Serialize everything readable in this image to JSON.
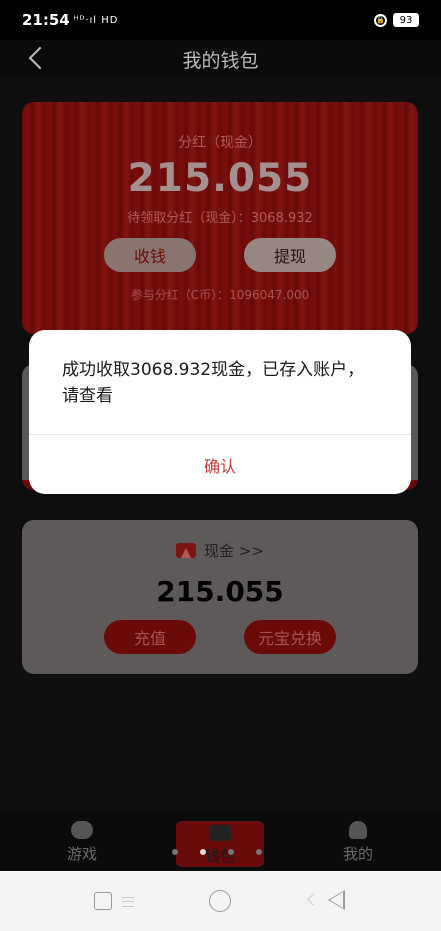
{
  "status_bar": {
    "time": "21:54",
    "signal": "ᴴᴰ·ıl HD",
    "battery": "93"
  },
  "nav": {
    "title": "我的钱包"
  },
  "dividend": {
    "label": "分红（现金）",
    "amount": "215.055",
    "pending": "待领取分红（现金）：3068.932",
    "collect_label": "收钱",
    "withdraw_label": "提现",
    "coin_dividend": "参与分红（C币）：1096047.000"
  },
  "cash": {
    "title": "现金 >>",
    "amount": "215.055",
    "recharge_label": "充值",
    "exchange_label": "元宝兑换"
  },
  "tabs": [
    {
      "label": "游戏",
      "icon": "gamepad-icon"
    },
    {
      "label": "钱包",
      "icon": "wallet-icon"
    },
    {
      "label": "我的",
      "icon": "user-icon"
    }
  ],
  "dialog": {
    "message": "成功收取3068.932现金，已存入账户，请查看",
    "confirm_label": "确认"
  },
  "colors": {
    "accent": "#c23c38",
    "card_red": "#6a0a08"
  }
}
